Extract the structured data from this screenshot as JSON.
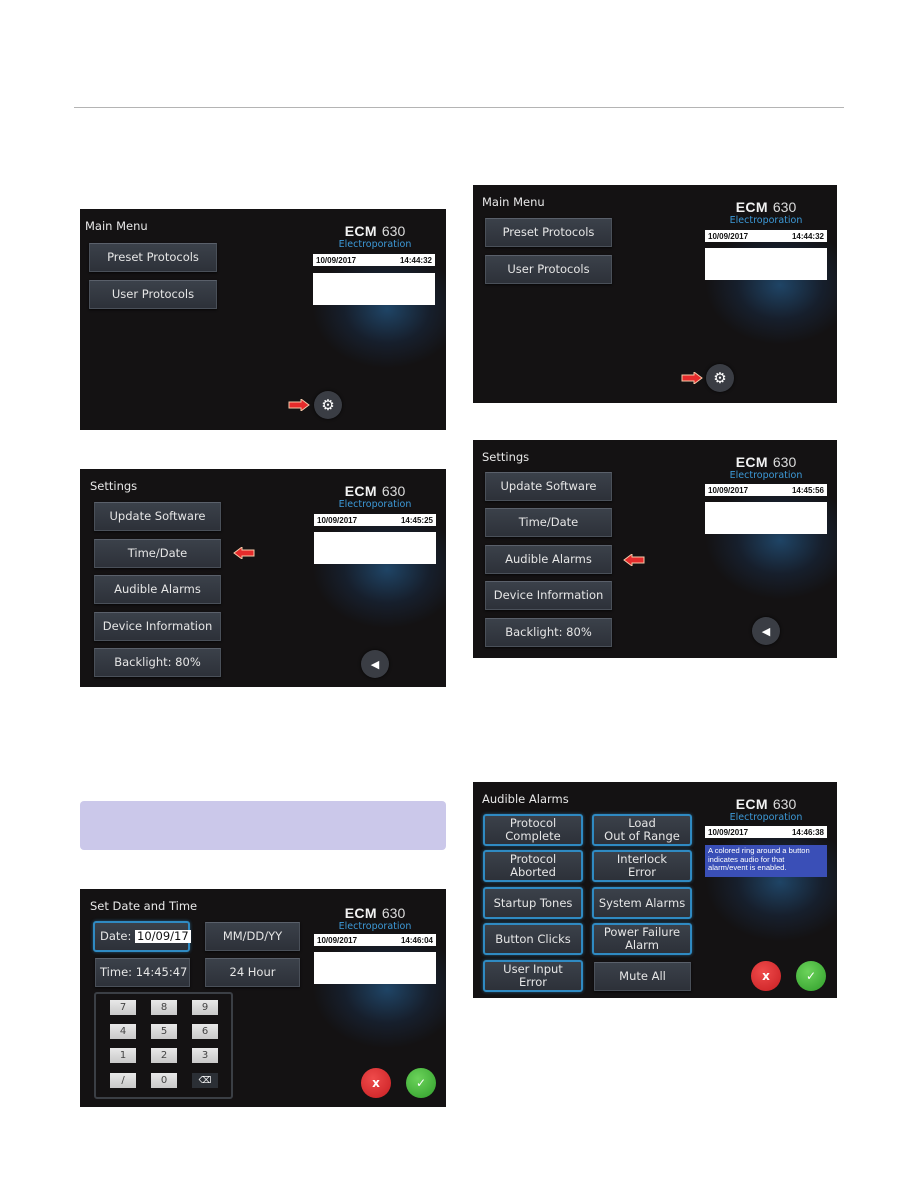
{
  "page": {
    "brand_name": "ECM",
    "brand_model": "630",
    "brand_subtitle": "Electroporation"
  },
  "screens": {
    "main_menu_1": {
      "title": "Main Menu",
      "buttons": [
        "Preset Protocols",
        "User Protocols"
      ],
      "date": "10/09/2017",
      "time": "14:44:32",
      "settings_icon": "gear-icon"
    },
    "main_menu_2": {
      "title": "Main Menu",
      "buttons": [
        "Preset Protocols",
        "User Protocols"
      ],
      "date": "10/09/2017",
      "time": "14:44:32",
      "settings_icon": "gear-icon"
    },
    "settings_1": {
      "title": "Settings",
      "buttons": [
        "Update Software",
        "Time/Date",
        "Audible Alarms",
        "Device Information",
        "Backlight:  80%"
      ],
      "date": "10/09/2017",
      "time": "14:45:25",
      "highlighted": "Time/Date"
    },
    "settings_2": {
      "title": "Settings",
      "buttons": [
        "Update Software",
        "Time/Date",
        "Audible Alarms",
        "Device Information",
        "Backlight:  80%"
      ],
      "date": "10/09/2017",
      "time": "14:45:56",
      "highlighted": "Audible Alarms"
    },
    "set_date_time": {
      "title": "Set Date and Time",
      "date_label": "Date:",
      "date_value": "10/09/17",
      "time_label": "Time:",
      "time_value": "14:45:47",
      "date_format": "MM/DD/YY",
      "time_format": "24 Hour",
      "keys": [
        "7",
        "8",
        "9",
        "4",
        "5",
        "6",
        "1",
        "2",
        "3",
        "/",
        "0",
        "⌫"
      ],
      "date": "10/09/2017",
      "time": "14:46:04",
      "cancel": "x",
      "confirm": "✓"
    },
    "audible_alarms": {
      "title": "Audible Alarms",
      "buttons_left": [
        "Protocol\nComplete",
        "Protocol\nAborted",
        "Startup Tones",
        "Button Clicks",
        "User Input\nError"
      ],
      "buttons_right": [
        "Load\nOut of Range",
        "Interlock\nError",
        "System Alarms",
        "Power Failure\nAlarm",
        "Mute All"
      ],
      "date": "10/09/2017",
      "time": "14:46:38",
      "info": "A colored ring around a button indicates audio for that alarm/event is enabled.",
      "cancel": "x",
      "confirm": "✓"
    }
  }
}
